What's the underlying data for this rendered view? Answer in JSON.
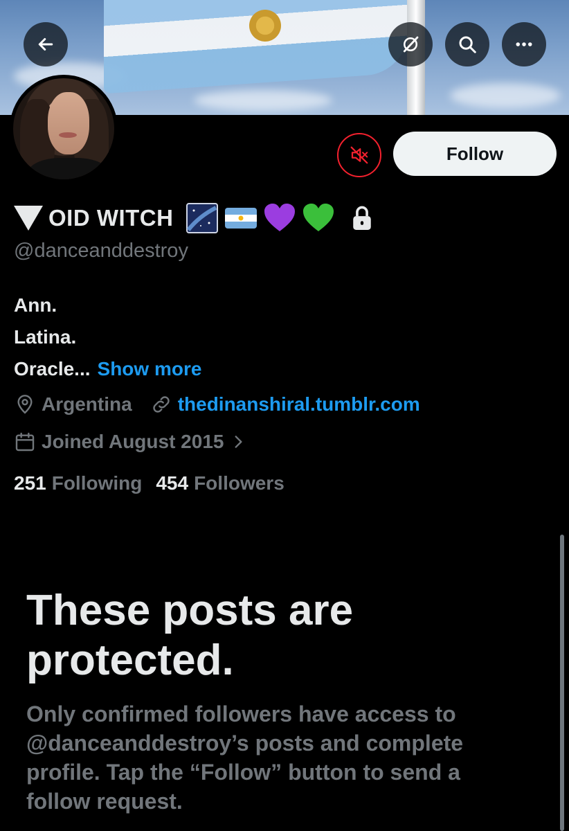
{
  "header": {
    "back_icon": "arrow-left-icon",
    "grok_icon": "grok-icon",
    "search_icon": "search-icon",
    "more_icon": "more-horizontal-icon"
  },
  "profile": {
    "display_name": "OID WITCH",
    "handle": "@danceanddestroy",
    "follow_label": "Follow",
    "muted_icon": "muted-speaker-icon",
    "bio_lines": [
      "Ann.",
      "Latina.",
      "Oracle..."
    ],
    "show_more": "Show more",
    "location": "Argentina",
    "website": "thedinanshiral.tumblr.com",
    "joined": "Joined August 2015",
    "following_count": "251",
    "following_label": "Following",
    "followers_count": "454",
    "followers_label": "Followers"
  },
  "protected": {
    "title": "These posts are protected.",
    "body": "Only confirmed followers have access to @danceanddestroy’s posts and complete profile. Tap the “Follow” button to send a follow request."
  },
  "colors": {
    "background": "#000000",
    "text": "#e7e9ea",
    "muted_text": "#71767b",
    "link": "#1d9bf0",
    "mute_border": "#f4212e",
    "follow_bg": "#eff3f4"
  }
}
